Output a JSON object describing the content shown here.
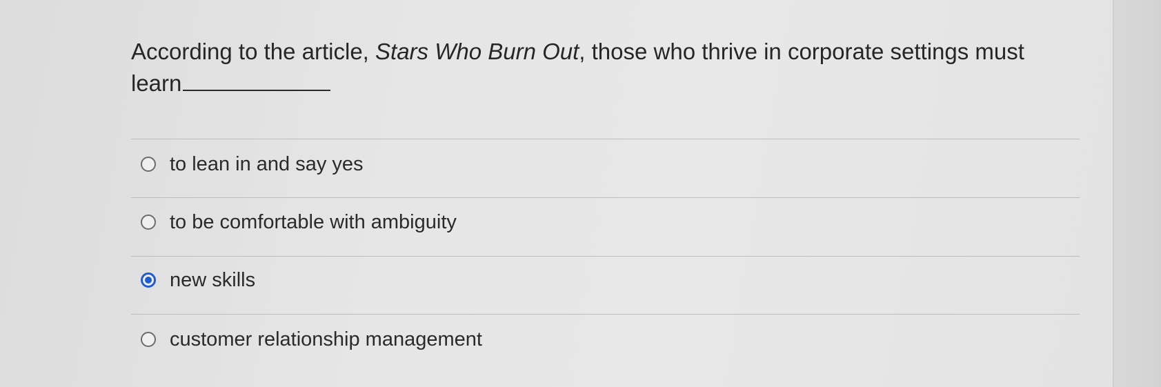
{
  "question": {
    "prefix": "According to the article, ",
    "title": "Stars Who Burn Out",
    "suffix": ",  those who thrive in corporate settings must",
    "line2": "learn"
  },
  "options": [
    {
      "label": "to lean in and say yes",
      "selected": false
    },
    {
      "label": "to be comfortable with ambiguity",
      "selected": false
    },
    {
      "label": "new skills",
      "selected": true
    },
    {
      "label": "customer relationship management",
      "selected": false
    }
  ],
  "colors": {
    "accent": "#1f5bd3",
    "text": "#262626",
    "divider": "#bdbdbd"
  }
}
